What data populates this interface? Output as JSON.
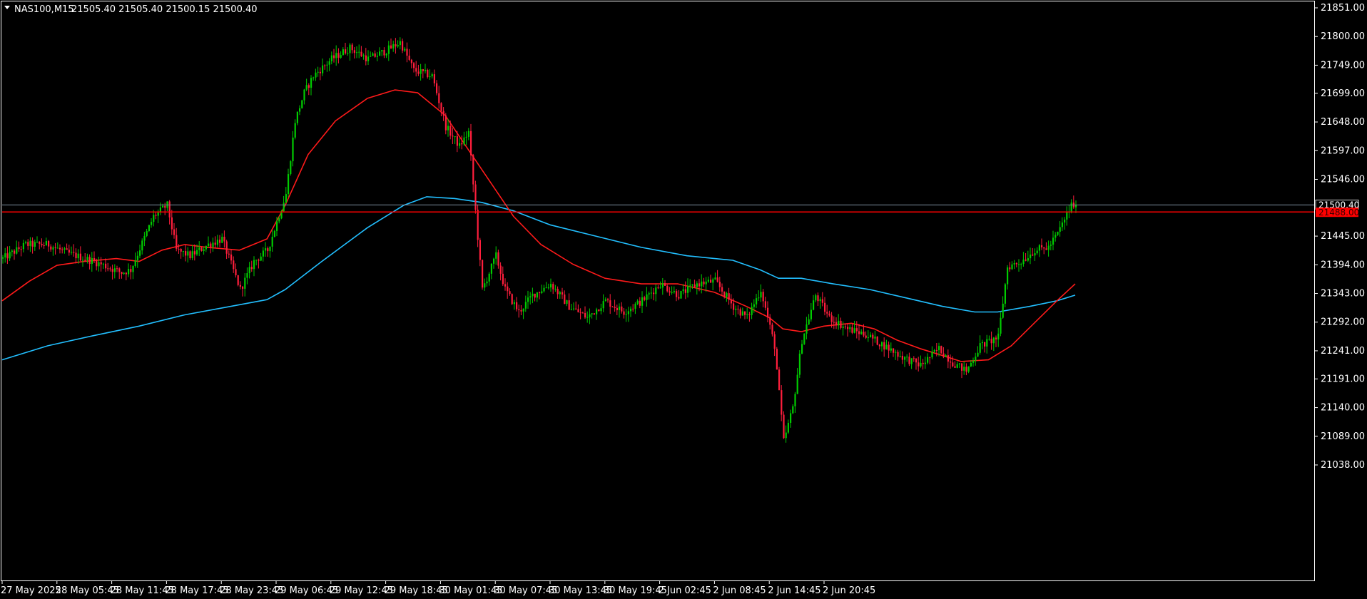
{
  "header": {
    "symbol": "NAS100,M15",
    "ohlc": "21505.40 21505.40 21500.15 21500.40"
  },
  "colors": {
    "background": "#000000",
    "axis": "#ffffff",
    "bull_candle": "#00cc00",
    "bear_candle": "#ff1e3c",
    "ma_fast": "#ff1a1a",
    "ma_slow": "#22bfff",
    "bid_line": "#7f8fa0",
    "hline": "#ff0000"
  },
  "chart_data": {
    "type": "candlestick",
    "y_ticks": [
      "21851.00",
      "21800.00",
      "21749.00",
      "21699.00",
      "21648.00",
      "21597.00",
      "21546.00",
      "21445.00",
      "21394.00",
      "21343.00",
      "21292.00",
      "21241.00",
      "21191.00",
      "21140.00",
      "21089.00",
      "21038.00"
    ],
    "ylim": [
      21020,
      21855
    ],
    "x_ticks": [
      "27 May 2025",
      "28 May 05:45",
      "28 May 11:45",
      "28 May 17:45",
      "28 May 23:45",
      "29 May 06:45",
      "29 May 12:45",
      "29 May 18:45",
      "30 May 01:45",
      "30 May 07:45",
      "30 May 13:45",
      "30 May 19:45",
      "2 Jun 02:45",
      "2 Jun 08:45",
      "2 Jun 14:45",
      "2 Jun 20:45"
    ],
    "bars_per_tick": 24,
    "current_price": 21500.4,
    "current_price_label": "21500.40",
    "horizontal_line": 21488.0,
    "horizontal_line_label": "21488.00",
    "waypoints": [
      [
        0,
        21405
      ],
      [
        10,
        21430
      ],
      [
        20,
        21430
      ],
      [
        28,
        21415
      ],
      [
        40,
        21400
      ],
      [
        52,
        21380
      ],
      [
        56,
        21385
      ],
      [
        66,
        21480
      ],
      [
        72,
        21500
      ],
      [
        76,
        21420
      ],
      [
        82,
        21410
      ],
      [
        90,
        21430
      ],
      [
        96,
        21440
      ],
      [
        104,
        21350
      ],
      [
        110,
        21400
      ],
      [
        116,
        21420
      ],
      [
        124,
        21520
      ],
      [
        128,
        21650
      ],
      [
        132,
        21700
      ],
      [
        136,
        21730
      ],
      [
        144,
        21760
      ],
      [
        152,
        21780
      ],
      [
        160,
        21760
      ],
      [
        168,
        21775
      ],
      [
        174,
        21790
      ],
      [
        180,
        21740
      ],
      [
        188,
        21730
      ],
      [
        194,
        21640
      ],
      [
        200,
        21605
      ],
      [
        204,
        21630
      ],
      [
        210,
        21350
      ],
      [
        216,
        21410
      ],
      [
        220,
        21350
      ],
      [
        226,
        21310
      ],
      [
        232,
        21340
      ],
      [
        240,
        21360
      ],
      [
        248,
        21320
      ],
      [
        256,
        21300
      ],
      [
        264,
        21330
      ],
      [
        272,
        21310
      ],
      [
        280,
        21330
      ],
      [
        288,
        21360
      ],
      [
        296,
        21340
      ],
      [
        304,
        21360
      ],
      [
        312,
        21365
      ],
      [
        320,
        21320
      ],
      [
        326,
        21300
      ],
      [
        332,
        21350
      ],
      [
        338,
        21250
      ],
      [
        342,
        21080
      ],
      [
        346,
        21140
      ],
      [
        350,
        21260
      ],
      [
        356,
        21340
      ],
      [
        362,
        21300
      ],
      [
        370,
        21280
      ],
      [
        378,
        21270
      ],
      [
        386,
        21250
      ],
      [
        394,
        21230
      ],
      [
        402,
        21215
      ],
      [
        410,
        21245
      ],
      [
        416,
        21220
      ],
      [
        422,
        21205
      ],
      [
        428,
        21250
      ],
      [
        436,
        21265
      ],
      [
        440,
        21390
      ],
      [
        446,
        21400
      ],
      [
        452,
        21420
      ],
      [
        458,
        21425
      ],
      [
        462,
        21450
      ],
      [
        468,
        21500
      ],
      [
        470,
        21500.4
      ]
    ],
    "ma_fast": [
      [
        0,
        21330
      ],
      [
        12,
        21365
      ],
      [
        24,
        21393
      ],
      [
        36,
        21400
      ],
      [
        50,
        21405
      ],
      [
        60,
        21400
      ],
      [
        70,
        21420
      ],
      [
        80,
        21430
      ],
      [
        90,
        21425
      ],
      [
        104,
        21420
      ],
      [
        116,
        21440
      ],
      [
        124,
        21500
      ],
      [
        134,
        21590
      ],
      [
        146,
        21650
      ],
      [
        160,
        21690
      ],
      [
        172,
        21705
      ],
      [
        182,
        21700
      ],
      [
        194,
        21660
      ],
      [
        204,
        21600
      ],
      [
        214,
        21540
      ],
      [
        224,
        21480
      ],
      [
        236,
        21430
      ],
      [
        250,
        21395
      ],
      [
        264,
        21370
      ],
      [
        280,
        21360
      ],
      [
        296,
        21360
      ],
      [
        312,
        21345
      ],
      [
        326,
        21320
      ],
      [
        336,
        21300
      ],
      [
        342,
        21280
      ],
      [
        350,
        21275
      ],
      [
        360,
        21285
      ],
      [
        372,
        21290
      ],
      [
        382,
        21280
      ],
      [
        392,
        21260
      ],
      [
        402,
        21245
      ],
      [
        410,
        21235
      ],
      [
        420,
        21222
      ],
      [
        432,
        21225
      ],
      [
        442,
        21250
      ],
      [
        452,
        21290
      ],
      [
        462,
        21330
      ],
      [
        470,
        21360
      ]
    ],
    "ma_slow": [
      [
        0,
        21225
      ],
      [
        20,
        21250
      ],
      [
        40,
        21268
      ],
      [
        60,
        21285
      ],
      [
        80,
        21305
      ],
      [
        100,
        21320
      ],
      [
        116,
        21332
      ],
      [
        124,
        21350
      ],
      [
        140,
        21400
      ],
      [
        160,
        21460
      ],
      [
        176,
        21500
      ],
      [
        186,
        21515
      ],
      [
        198,
        21512
      ],
      [
        210,
        21505
      ],
      [
        224,
        21490
      ],
      [
        240,
        21465
      ],
      [
        260,
        21445
      ],
      [
        280,
        21425
      ],
      [
        300,
        21410
      ],
      [
        320,
        21402
      ],
      [
        332,
        21385
      ],
      [
        340,
        21370
      ],
      [
        350,
        21370
      ],
      [
        364,
        21360
      ],
      [
        380,
        21350
      ],
      [
        396,
        21335
      ],
      [
        412,
        21320
      ],
      [
        426,
        21310
      ],
      [
        436,
        21310
      ],
      [
        450,
        21320
      ],
      [
        462,
        21330
      ],
      [
        470,
        21340
      ]
    ]
  }
}
